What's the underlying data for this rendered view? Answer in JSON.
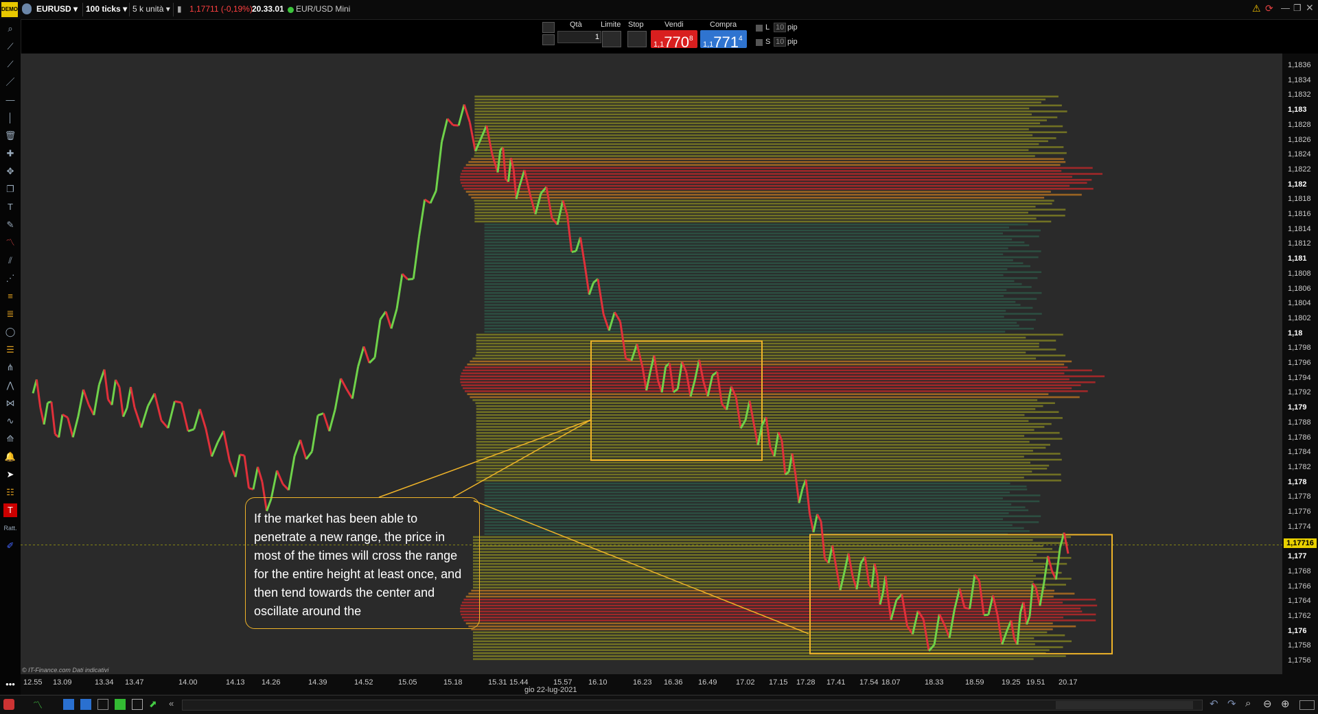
{
  "titlebar": {
    "demo_badge": "DEMO",
    "symbol": "EURUSD",
    "timeframe": "100 ticks",
    "units": "5 k unità",
    "price_change": "1,17711 (-0,19%)",
    "time": "20.33.01",
    "instrument": "EUR/USD Mini"
  },
  "order_bar": {
    "qty_label": "Qtà",
    "qty_value": "1",
    "limit_label": "Limite",
    "stop_label": "Stop",
    "sell_label": "Vendi",
    "buy_label": "Compra",
    "sell_prefix": "1,1",
    "sell_main": "770",
    "sell_sup": "8",
    "buy_prefix": "1,1",
    "buy_main": "771",
    "buy_sup": "4",
    "l_label": "L",
    "s_label": "S",
    "l_pips": "10",
    "s_pips": "10",
    "pip_label": "pip"
  },
  "y_axis": {
    "ticks": [
      {
        "label": "1,1836",
        "major": false
      },
      {
        "label": "1,1834",
        "major": false
      },
      {
        "label": "1,1832",
        "major": false
      },
      {
        "label": "1,183",
        "major": true
      },
      {
        "label": "1,1828",
        "major": false
      },
      {
        "label": "1,1826",
        "major": false
      },
      {
        "label": "1,1824",
        "major": false
      },
      {
        "label": "1,1822",
        "major": false
      },
      {
        "label": "1,182",
        "major": true
      },
      {
        "label": "1,1818",
        "major": false
      },
      {
        "label": "1,1816",
        "major": false
      },
      {
        "label": "1,1814",
        "major": false
      },
      {
        "label": "1,1812",
        "major": false
      },
      {
        "label": "1,181",
        "major": true
      },
      {
        "label": "1,1808",
        "major": false
      },
      {
        "label": "1,1806",
        "major": false
      },
      {
        "label": "1,1804",
        "major": false
      },
      {
        "label": "1,1802",
        "major": false
      },
      {
        "label": "1,18",
        "major": true
      },
      {
        "label": "1,1798",
        "major": false
      },
      {
        "label": "1,1796",
        "major": false
      },
      {
        "label": "1,1794",
        "major": false
      },
      {
        "label": "1,1792",
        "major": false
      },
      {
        "label": "1,179",
        "major": true
      },
      {
        "label": "1,1788",
        "major": false
      },
      {
        "label": "1,1786",
        "major": false
      },
      {
        "label": "1,1784",
        "major": false
      },
      {
        "label": "1,1782",
        "major": false
      },
      {
        "label": "1,178",
        "major": true
      },
      {
        "label": "1,1778",
        "major": false
      },
      {
        "label": "1,1776",
        "major": false
      },
      {
        "label": "1,1774",
        "major": false
      },
      {
        "label": "",
        "major": false
      },
      {
        "label": "1,177",
        "major": true
      },
      {
        "label": "1,1768",
        "major": false
      },
      {
        "label": "1,1766",
        "major": false
      },
      {
        "label": "1,1764",
        "major": false
      },
      {
        "label": "1,1762",
        "major": false
      },
      {
        "label": "1,176",
        "major": true
      },
      {
        "label": "1,1758",
        "major": false
      },
      {
        "label": "1,1756",
        "major": false
      }
    ],
    "current_price": "1,17716"
  },
  "x_axis": {
    "ticks": [
      "12.55",
      "13.09",
      "13.34",
      "13.47",
      "14.00",
      "14.13",
      "14.26",
      "14.39",
      "14.52",
      "15.05",
      "15.18",
      "15.31",
      "15.44",
      "15.57",
      "16.10",
      "16.23",
      "16.36",
      "16.49",
      "17.02",
      "17.15",
      "17.28",
      "17.41",
      "17.54",
      "18.07",
      "18.33",
      "18.59",
      "19.25",
      "19.51",
      "20.17"
    ],
    "date_label": "gio 22-lug-2021"
  },
  "annotation": {
    "text": "If the market has been able to penetrate a new range, the price in most of the times will cross the range for the entire height at least once, and then tend towards the center and oscillate around the"
  },
  "credit": "© IT-Finance.com Dati indicativi",
  "colors": {
    "background": "#2a2a2a",
    "up_candle": "#6fd24a",
    "down_candle": "#e0303a",
    "box_outline": "#f0b429",
    "sell_button": "#d91f1f",
    "buy_button": "#2f74d0"
  },
  "chart_data": {
    "type": "line",
    "title": "",
    "xlabel": "",
    "ylabel": "",
    "x": [
      "12.55",
      "13.09",
      "13.34",
      "13.47",
      "14.00",
      "14.13",
      "14.26",
      "14.39",
      "14.52",
      "15.05",
      "15.18",
      "15.31",
      "15.44",
      "15.57",
      "16.10",
      "16.23",
      "16.36",
      "16.49",
      "17.02",
      "17.15",
      "17.28",
      "17.41",
      "17.54",
      "18.07",
      "18.33",
      "18.59",
      "19.25",
      "19.51",
      "20.17"
    ],
    "ylim": [
      1.1755,
      1.1837
    ],
    "series": [
      {
        "values": [
          1.1792,
          1.1787,
          1.1793,
          1.179,
          1.1789,
          1.1783,
          1.1778,
          1.1787,
          1.1796,
          1.1807,
          1.183,
          1.1824,
          1.182,
          1.1816,
          1.1805,
          1.1795,
          1.1794,
          1.1794,
          1.1789,
          1.1785,
          1.1778,
          1.1768,
          1.1768,
          1.1764,
          1.1759,
          1.1766,
          1.1759,
          1.1765,
          1.1772
        ]
      }
    ],
    "volume_profile_peaks": [
      1.1821,
      1.1794,
      1.1763
    ],
    "highlighted_ranges": [
      {
        "x_start": "16.10",
        "x_end": "16.49",
        "y_low": 1.1783,
        "y_high": 1.1799
      },
      {
        "x_start": "17.41",
        "x_end": "20.17",
        "y_low": 1.1757,
        "y_high": 1.1773
      }
    ],
    "current_price": 1.17716
  }
}
